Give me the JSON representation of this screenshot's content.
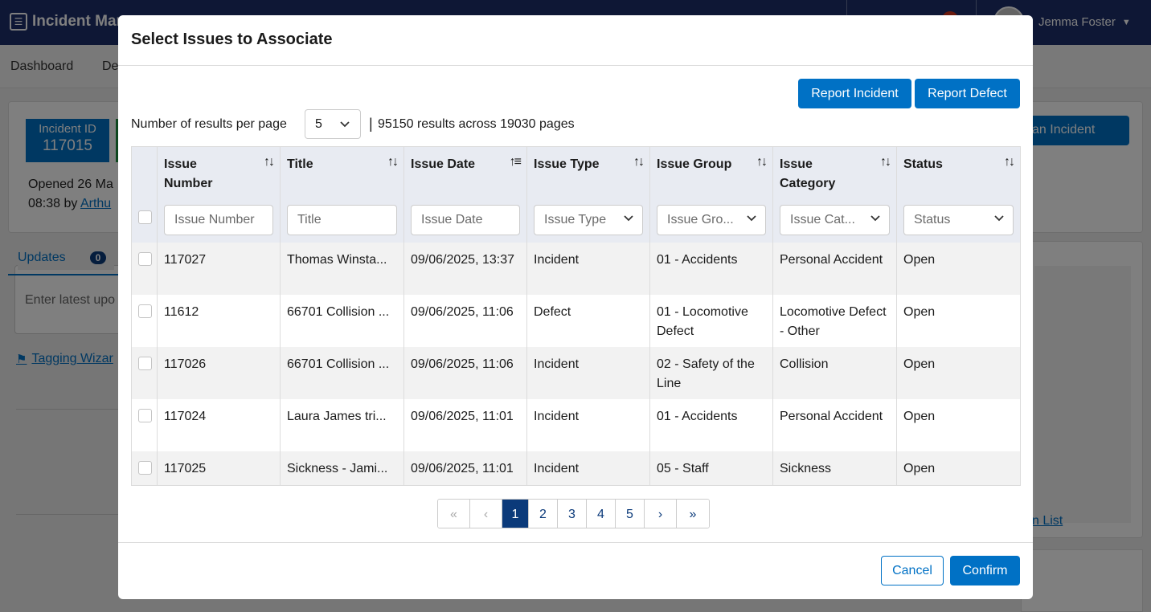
{
  "app": {
    "title": "Incident Mar",
    "user_name": "Jemma Foster"
  },
  "nav": {
    "items": [
      "Dashboard",
      "De"
    ]
  },
  "incident": {
    "id_label": "Incident ID",
    "id_value": "117015",
    "opened_line1": "Opened 26 Ma",
    "opened_line2_prefix": "08:38 by ",
    "opened_by": "Arthu"
  },
  "updates": {
    "tab_label": "Updates",
    "count": "0",
    "latest_placeholder": "Enter latest upo",
    "tagging_link": "Tagging Wizar"
  },
  "right": {
    "plan_button": "an Incident",
    "list_link": "n List"
  },
  "modal": {
    "title": "Select Issues to Associate",
    "report_incident": "Report Incident",
    "report_defect": "Report Defect",
    "rpp_label": "Number of results per page",
    "rpp_value": "5",
    "results_sep": "|",
    "results_text": "95150 results across 19030 pages",
    "cancel": "Cancel",
    "confirm": "Confirm"
  },
  "table": {
    "columns": [
      {
        "label": "Issue Number",
        "filter": "Issue Number",
        "type": "text"
      },
      {
        "label": "Title",
        "filter": "Title",
        "type": "text"
      },
      {
        "label": "Issue Date",
        "filter": "Issue Date",
        "type": "text"
      },
      {
        "label": "Issue Type",
        "filter": "Issue Type",
        "type": "select"
      },
      {
        "label": "Issue Group",
        "filter": "Issue Gro...",
        "type": "select"
      },
      {
        "label": "Issue Category",
        "filter": "Issue Cat...",
        "type": "select"
      },
      {
        "label": "Status",
        "filter": "Status",
        "type": "select"
      }
    ],
    "rows": [
      [
        "117027",
        "Thomas Winsta...",
        "09/06/2025, 13:37",
        "Incident",
        "01 - Accidents",
        "Personal Accident",
        "Open"
      ],
      [
        "11612",
        "66701 Collision ...",
        "09/06/2025, 11:06",
        "Defect",
        "01 - Locomotive Defect",
        "Locomotive Defect - Other",
        "Open"
      ],
      [
        "117026",
        "66701 Collision ...",
        "09/06/2025, 11:06",
        "Incident",
        "02 - Safety of the Line",
        "Collision",
        "Open"
      ],
      [
        "117024",
        "Laura James tri...",
        "09/06/2025, 11:01",
        "Incident",
        "01 - Accidents",
        "Personal Accident",
        "Open"
      ],
      [
        "117025",
        "Sickness - Jami...",
        "09/06/2025, 11:01",
        "Incident",
        "05 - Staff",
        "Sickness",
        "Open"
      ]
    ]
  },
  "pager": {
    "first": "«",
    "prev": "‹",
    "pages": [
      "1",
      "2",
      "3",
      "4",
      "5"
    ],
    "next": "›",
    "last": "»",
    "current": "1"
  },
  "colors": {
    "primary": "#0071c5",
    "navy": "#1d2f6b",
    "active_page": "#0b3a7a",
    "header_row": "#e8ebf2"
  }
}
